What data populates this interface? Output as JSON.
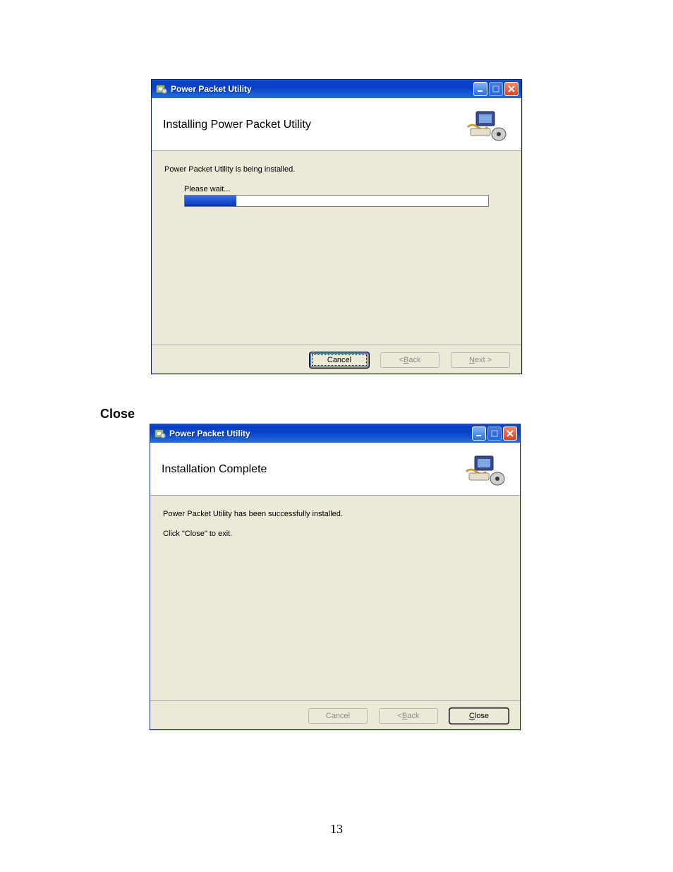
{
  "doc": {
    "section_label": "Close",
    "page_number": "13"
  },
  "window1": {
    "title": "Power Packet Utility",
    "header": "Installing Power Packet Utility",
    "body_text": "Power Packet Utility  is being installed.",
    "progress_label": "Please wait...",
    "progress_percent": 17,
    "buttons": {
      "cancel": "Cancel",
      "back_prefix": "< ",
      "back_mn": "B",
      "back_rest": "ack",
      "next_mn": "N",
      "next_rest": "ext >"
    }
  },
  "window2": {
    "title": "Power Packet Utility",
    "header": "Installation Complete",
    "body_text1": "Power Packet Utility  has been successfully installed.",
    "body_text2": "Click \"Close\" to exit.",
    "buttons": {
      "cancel": "Cancel",
      "back_prefix": "< ",
      "back_mn": "B",
      "back_rest": "ack",
      "close_mn": "C",
      "close_rest": "lose"
    }
  }
}
